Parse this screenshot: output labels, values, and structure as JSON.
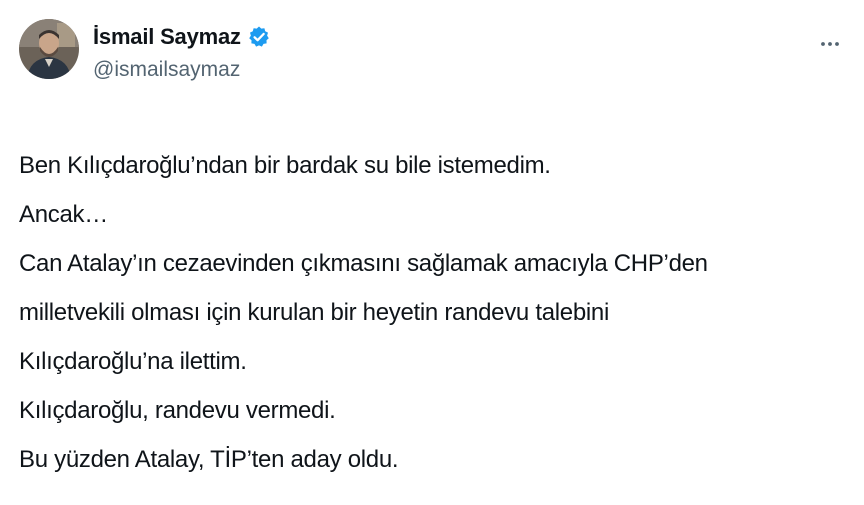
{
  "author": {
    "display_name": "İsmail Saymaz",
    "handle": "@ismailsaymaz",
    "verified": true
  },
  "tweet": {
    "lines": [
      "Ben Kılıçdaroğlu’ndan bir bardak su bile istemedim.",
      "Ancak…",
      "Can Atalay’ın cezaevinden çıkmasını sağlamak amacıyla CHP’den",
      "milletvekili olması için kurulan bir heyetin randevu talebini",
      "Kılıçdaroğlu’na ilettim.",
      "Kılıçdaroğlu, randevu vermedi.",
      "Bu yüzden Atalay, TİP’ten aday oldu."
    ]
  },
  "icons": {
    "verified": "verified-badge-icon",
    "more": "more-options-icon"
  },
  "colors": {
    "verified_blue": "#1d9bf0",
    "handle_gray": "#536471",
    "text": "#0f1419"
  }
}
